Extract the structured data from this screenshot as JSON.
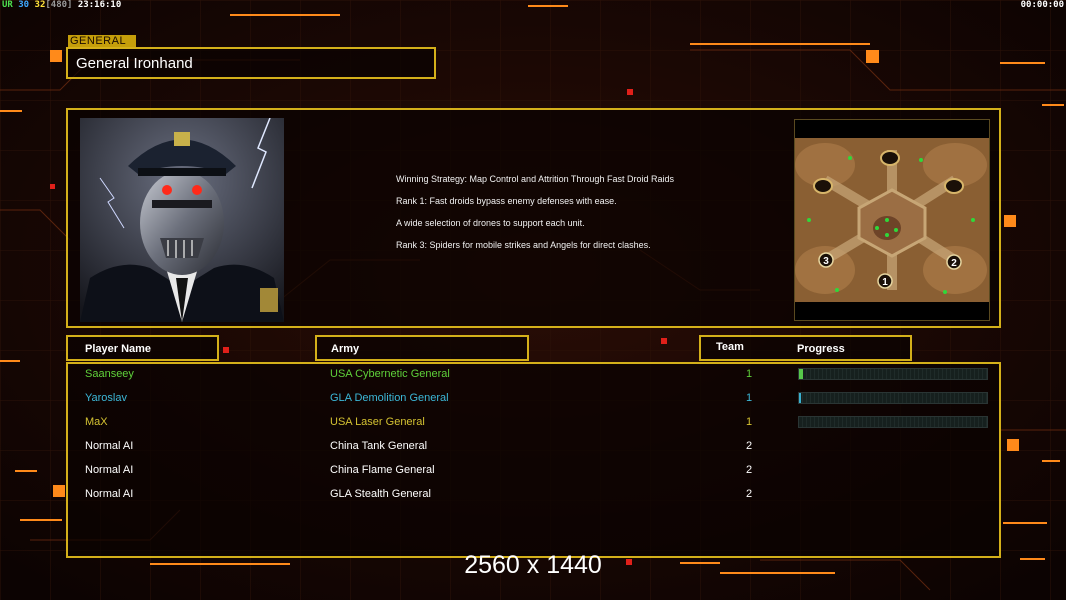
{
  "hud": {
    "ur": "UR",
    "n1": "30",
    "n2": "32",
    "bracket": "[480]",
    "clock": "23:16:10",
    "timer": "00:00:00"
  },
  "general_tag": "GENERAL",
  "general_name": "General Ironhand",
  "description": [
    "Winning Strategy: Map Control and Attrition Through Fast Droid Raids",
    "Rank 1: Fast droids bypass enemy defenses with ease.",
    "A wide selection of drones to support each unit.",
    "Rank 3: Spiders for mobile strikes and Angels for direct clashes."
  ],
  "headers": {
    "player": "Player Name",
    "army": "Army",
    "team": "Team",
    "progress": "Progress"
  },
  "players": [
    {
      "name": "Saanseey",
      "army": "USA Cybernetic General",
      "team": "1",
      "color": "#5fd13a",
      "progress": 0.02,
      "bar_color": "#56c84a"
    },
    {
      "name": "Yaroslav",
      "army": "GLA Demolition General",
      "team": "1",
      "color": "#3cb8d8",
      "progress": 0.01,
      "bar_color": "#3ab0cf"
    },
    {
      "name": "MaX",
      "army": "USA Laser General",
      "team": "1",
      "color": "#d4c232",
      "progress": 0.0,
      "bar_color": "#d4c232"
    },
    {
      "name": "Normal AI",
      "army": "China Tank General",
      "team": "2",
      "color": "#ffffff"
    },
    {
      "name": "Normal AI",
      "army": "China Flame General",
      "team": "2",
      "color": "#ffffff"
    },
    {
      "name": "Normal AI",
      "army": "GLA Stealth General",
      "team": "2",
      "color": "#ffffff"
    }
  ],
  "map_starts": [
    "3",
    "1",
    "2"
  ],
  "resolution": "2560 x 1440",
  "colors": {
    "frame": "#d4b01a",
    "accent": "#ff8a1a"
  }
}
